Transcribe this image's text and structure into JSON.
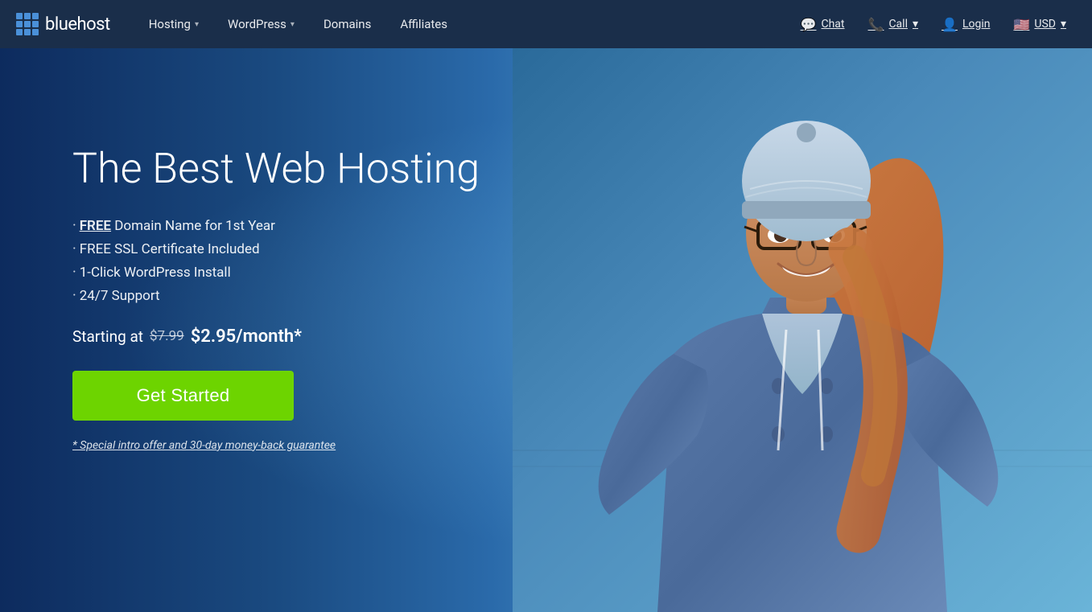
{
  "brand": {
    "name": "bluehost"
  },
  "navbar": {
    "links": [
      {
        "id": "hosting",
        "label": "Hosting",
        "hasDropdown": true
      },
      {
        "id": "wordpress",
        "label": "WordPress",
        "hasDropdown": true
      },
      {
        "id": "domains",
        "label": "Domains",
        "hasDropdown": false
      },
      {
        "id": "affiliates",
        "label": "Affiliates",
        "hasDropdown": false
      }
    ],
    "right": [
      {
        "id": "chat",
        "label": "Chat",
        "icon": "chat-bubble"
      },
      {
        "id": "call",
        "label": "Call",
        "icon": "phone",
        "hasDropdown": true
      },
      {
        "id": "login",
        "label": "Login",
        "icon": "user"
      },
      {
        "id": "currency",
        "label": "USD",
        "icon": "flag",
        "hasDropdown": true
      }
    ]
  },
  "hero": {
    "title": "The Best Web Hosting",
    "features": [
      {
        "bullet": "·",
        "free_label": "FREE",
        "text": " Domain Name for 1st Year"
      },
      {
        "bullet": "·",
        "text": "FREE SSL Certificate Included"
      },
      {
        "bullet": "·",
        "text": "1-Click WordPress Install"
      },
      {
        "bullet": "·",
        "text": "24/7 Support"
      }
    ],
    "pricing": {
      "prefix": "Starting at",
      "old_price": "$7.99",
      "new_price": "$2.95/month*"
    },
    "cta_button": "Get Started",
    "note": "* Special intro offer and 30-day money-back guarantee"
  }
}
